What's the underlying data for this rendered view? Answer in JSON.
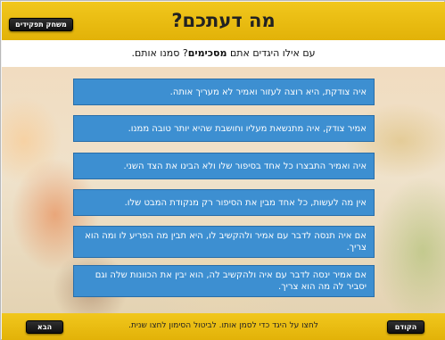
{
  "header": {
    "title": "מה דעתכם?",
    "roles_button": "משחק תפקידים"
  },
  "instruction": {
    "before": "עם אילו היגדים אתם ",
    "bold": "מסכימים",
    "after": "? סמנו אותם."
  },
  "statements": [
    "איה צודקת, היא רוצה לעזור ואמיר לא מעריך אותה.",
    "אמיר צודק, איה מתנשאת מעליו וחושבת שהיא יותר טובה ממנו.",
    "איה ואמיר התבצרו כל אחד בסיפור שלו ולא הבינו את הצד השני.",
    "אין מה לעשות, כל אחד מבין את הסיפור רק מנקודת המבט שלו.",
    "אם איה תנסה לדבר עם אמיר ולהקשיב לו, היא תבין מה הפריע לו ומה הוא צריך.",
    "אם אמיר ינסה לדבר עם איה ולהקשיב לה, הוא יבין את הכוונות שלה וגם יסביר לה מה הוא צריך."
  ],
  "footer": {
    "hint": "לחצו על היגד כדי לסמן אותו. לביטול הסימון לחצו שנית.",
    "next_button": "הבא",
    "prev_button": "הקודם"
  },
  "colors": {
    "header_yellow": "#e8ba0f",
    "statement_blue": "#3d8fd1"
  }
}
